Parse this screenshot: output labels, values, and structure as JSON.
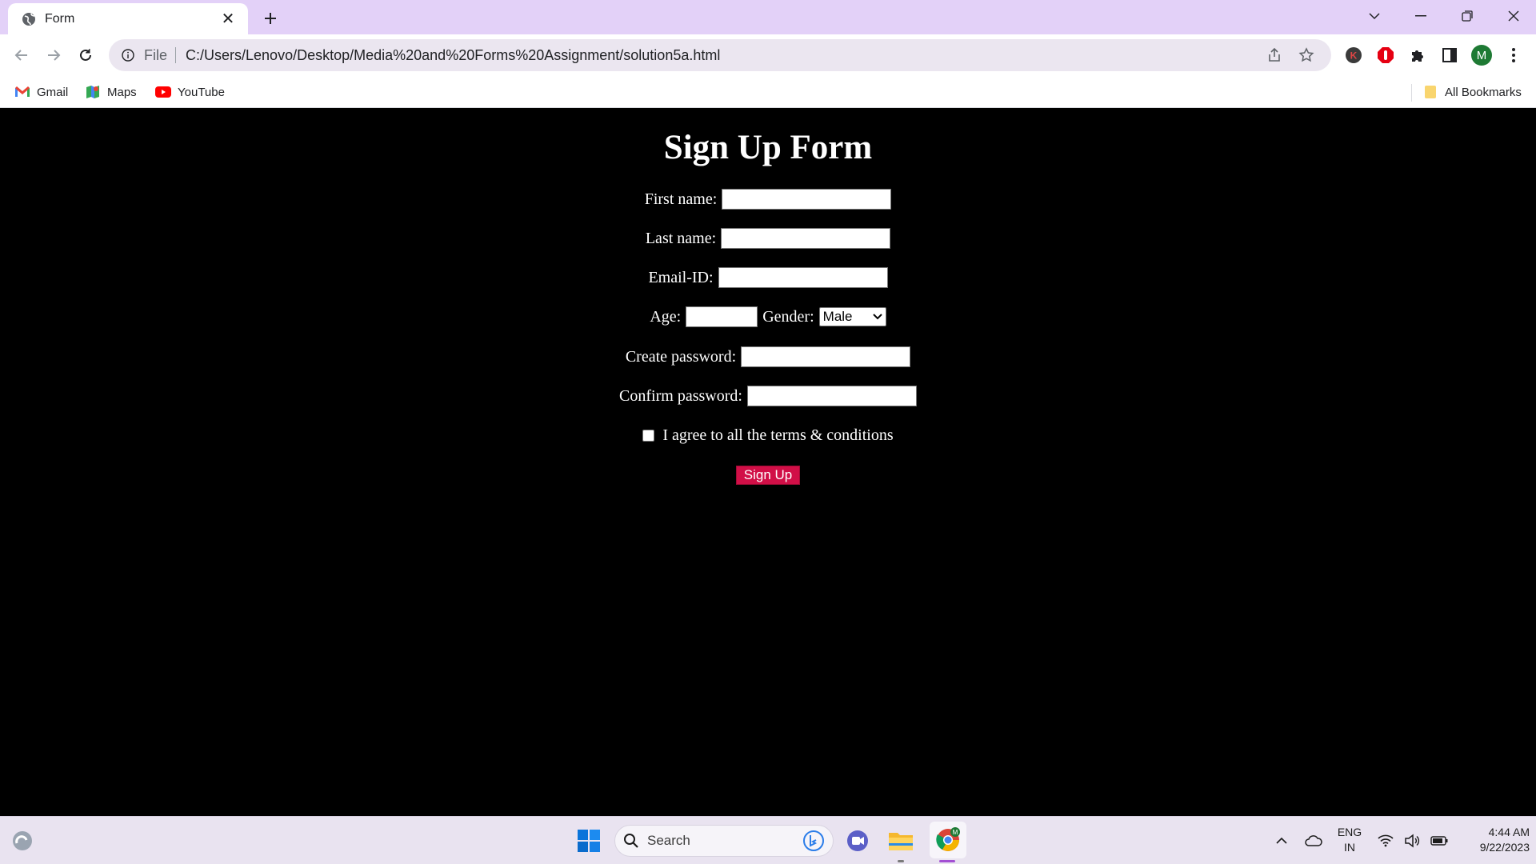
{
  "browser": {
    "tab": {
      "title": "Form"
    },
    "omnibox": {
      "scheme_label": "File",
      "url": "C:/Users/Lenovo/Desktop/Media%20and%20Forms%20Assignment/solution5a.html"
    },
    "profile_initial": "M",
    "bookmarks": [
      {
        "label": "Gmail",
        "icon": "gmail-icon"
      },
      {
        "label": "Maps",
        "icon": "maps-icon"
      },
      {
        "label": "YouTube",
        "icon": "youtube-icon"
      }
    ],
    "all_bookmarks_label": "All Bookmarks"
  },
  "form": {
    "title": "Sign Up Form",
    "first_name_label": "First name:",
    "last_name_label": "Last name:",
    "email_label": "Email-ID:",
    "age_label": "Age:",
    "gender_label": "Gender:",
    "gender_selected": "Male",
    "create_password_label": "Create password:",
    "confirm_password_label": "Confirm password:",
    "terms_label": "I agree to all the terms & conditions",
    "terms_checked": false,
    "submit_label": "Sign Up",
    "submit_color": "#d10f47"
  },
  "taskbar": {
    "search_placeholder": "Search",
    "language": "ENG",
    "region": "IN",
    "time": "4:44 AM",
    "date": "9/22/2023"
  }
}
